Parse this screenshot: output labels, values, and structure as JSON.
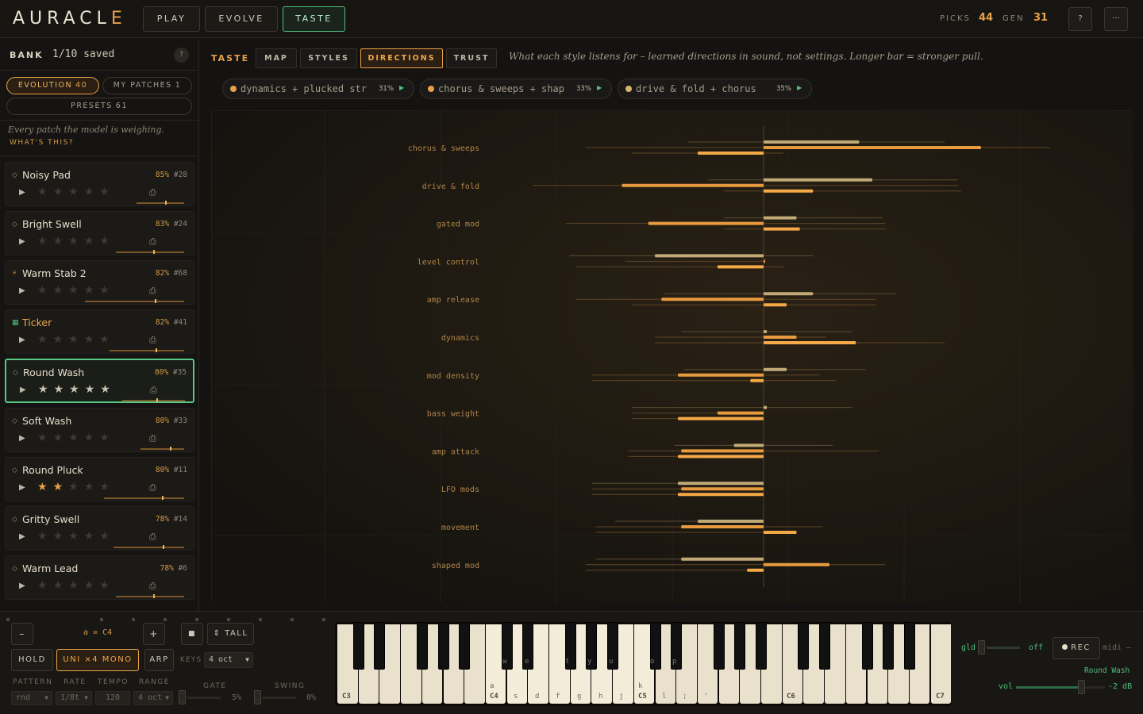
{
  "app": {
    "title": "AURACLE",
    "nav_tabs": [
      {
        "label": "PLAY"
      },
      {
        "label": "EVOLVE"
      },
      {
        "label": "TASTE"
      }
    ],
    "stats": {
      "picks_label": "PICKS",
      "picks_value": "44",
      "gen_label": "GEN",
      "gen_value": "31"
    },
    "help_label": "?",
    "more_label": "···"
  },
  "sidebar": {
    "bank_label": "BANK",
    "bank_saved": "1/10 saved",
    "help_label": "?",
    "filters": {
      "evolution_label": "EVOLUTION",
      "evolution_count": "40",
      "my_patches_label": "MY PATCHES",
      "my_patches_count": "1",
      "presets_label": "PRESETS",
      "presets_count": "61"
    },
    "note": "Every patch the model is weighing.",
    "what_label": "WHAT'S THIS?",
    "patches": [
      {
        "name": "Noisy Pad",
        "match": "85%",
        "id": "#28",
        "glyph": "◇",
        "stars": 0,
        "marker": 0.6
      },
      {
        "name": "Bright Swell",
        "match": "83%",
        "id": "#24",
        "glyph": "◇",
        "stars": 0,
        "marker": 0.55
      },
      {
        "name": "Warm Stab 2",
        "match": "82%",
        "id": "#68",
        "glyph": "⚡",
        "stars": 0,
        "marker": 0.7
      },
      {
        "name": "Ticker",
        "match": "82%",
        "id": "#41",
        "glyph": "▦",
        "stars": 0,
        "marker": 0.62
      },
      {
        "name": "Round Wash",
        "match": "80%",
        "id": "#35",
        "glyph": "◇",
        "stars": 5,
        "marker": 0.55
      },
      {
        "name": "Soft Wash",
        "match": "80%",
        "id": "#33",
        "glyph": "◇",
        "stars": 0,
        "marker": 0.68
      },
      {
        "name": "Round Pluck",
        "match": "80%",
        "id": "#11",
        "glyph": "◇",
        "stars": 2,
        "marker": 0.72
      },
      {
        "name": "Gritty Swell",
        "match": "78%",
        "id": "#14",
        "glyph": "◇",
        "stars": 0,
        "marker": 0.7
      },
      {
        "name": "Warm Lead",
        "match": "78%",
        "id": "#6",
        "glyph": "◇",
        "stars": 0,
        "marker": 0.55
      }
    ],
    "play_glyph": "▶",
    "star_glyph": "★",
    "save_glyph": "⎙"
  },
  "main": {
    "section_label": "TASTE",
    "subtabs": [
      {
        "label": "MAP"
      },
      {
        "label": "STYLES"
      },
      {
        "label": "DIRECTIONS"
      },
      {
        "label": "TRUST"
      }
    ],
    "description": "What each style listens for – learned directions in sound, not settings. Longer bar = stronger pull.",
    "styles": [
      {
        "label": "dynamics + plucked str",
        "pct": "31%",
        "color": "#e8a147"
      },
      {
        "label": "chorus & sweeps + shap",
        "pct": "33%",
        "color": "#e8a147"
      },
      {
        "label": "drive & fold + chorus",
        "pct": "35%",
        "color": "#d9b46a"
      }
    ],
    "play_glyph": "▶"
  },
  "chart_data": {
    "type": "bar",
    "orientation": "horizontal",
    "center": 0,
    "xlim": [
      -1,
      1
    ],
    "categories": [
      "chorus & sweeps",
      "drive & fold",
      "gated mod",
      "level control",
      "amp release",
      "dynamics",
      "mod density",
      "bass weight",
      "amp attack",
      "LFO mods",
      "movement",
      "shaped mod"
    ],
    "series": [
      {
        "color": "#d9bf86",
        "values": [
          0.29,
          0.33,
          0.1,
          -0.33,
          0.15,
          0.01,
          0.07,
          0.01,
          -0.09,
          -0.26,
          -0.2,
          -0.25
        ],
        "ranges": [
          [
            -0.23,
            0.55
          ],
          [
            -0.17,
            0.59
          ],
          [
            -0.12,
            0.36
          ],
          [
            -0.59,
            0.15
          ],
          [
            -0.3,
            0.4
          ],
          [
            -0.25,
            0.27
          ],
          [
            -0.24,
            0.31
          ],
          [
            -0.4,
            0.27
          ],
          [
            -0.27,
            0.21
          ],
          [
            -0.52,
            0.0
          ],
          [
            -0.45,
            0.0
          ],
          [
            -0.51,
            0.0
          ]
        ]
      },
      {
        "color": "#f0a040",
        "values": [
          0.66,
          -0.43,
          -0.35,
          0.0,
          -0.31,
          0.1,
          -0.26,
          -0.14,
          -0.25,
          -0.25,
          -0.25,
          0.2
        ],
        "ranges": [
          [
            -0.54,
            0.87
          ],
          [
            -0.7,
            0.59
          ],
          [
            -0.6,
            0.37
          ],
          [
            -0.42,
            0.0
          ],
          [
            -0.57,
            0.34
          ],
          [
            -0.33,
            0.19
          ],
          [
            -0.52,
            0.17
          ],
          [
            -0.4,
            0.0
          ],
          [
            -0.41,
            0.35
          ],
          [
            -0.52,
            0.0
          ],
          [
            -0.51,
            0.18
          ],
          [
            -0.54,
            0.37
          ]
        ]
      },
      {
        "color": "#ffb04a",
        "values": [
          -0.2,
          0.15,
          0.11,
          -0.14,
          0.07,
          0.28,
          -0.04,
          -0.26,
          -0.26,
          -0.26,
          0.1,
          -0.05
        ],
        "ranges": [
          [
            -0.4,
            0.06
          ],
          [
            -0.12,
            0.6
          ],
          [
            -0.12,
            0.37
          ],
          [
            -0.57,
            0.06
          ],
          [
            -0.4,
            0.34
          ],
          [
            -0.33,
            0.55
          ],
          [
            -0.52,
            0.22
          ],
          [
            -0.4,
            0.0
          ],
          [
            -0.41,
            0.0
          ],
          [
            -0.52,
            0.0
          ],
          [
            -0.51,
            0.0
          ],
          [
            -0.54,
            0.0
          ]
        ]
      }
    ]
  },
  "bottom": {
    "minus_label": "–",
    "plus_label": "+",
    "octave_label": "a = C4",
    "stop_glyph": "■",
    "tall_label": "⇕ TALL",
    "hold_label": "HOLD",
    "voice_label": "UNI ×4 MONO",
    "arp_label": "ARP",
    "keys_label": "KEYS",
    "keys_value": "4 oct",
    "pattern_label": "PATTERN",
    "pattern_value": "rnd",
    "rate_label": "RATE",
    "rate_value": "1/8t",
    "tempo_label": "TEMPO",
    "tempo_value": "120",
    "range_label": "RANGE",
    "range_value": "4 oct",
    "gate_label": "GATE",
    "gate_value": "5%",
    "swing_label": "SWING",
    "swing_value": "0%",
    "piano_labels": [
      {
        "text": "C3"
      },
      {
        "text": "a"
      },
      {
        "text": "C4"
      },
      {
        "text": "s"
      },
      {
        "text": "d"
      },
      {
        "text": "f"
      },
      {
        "text": "g"
      },
      {
        "text": "h"
      },
      {
        "text": "j"
      },
      {
        "text": "k"
      },
      {
        "text": "C5"
      },
      {
        "text": "l"
      },
      {
        "text": ";"
      },
      {
        "text": "'"
      },
      {
        "text": "C6"
      },
      {
        "text": "C7"
      }
    ],
    "black_key_labels": [
      "w",
      "e",
      "t",
      "y",
      "u",
      "o",
      "p"
    ],
    "glide_label": "gld",
    "glide_value": "off",
    "rec_label": "REC",
    "midi_label": "midi –",
    "patch_name": "Round Wash",
    "vol_label": "vol",
    "vol_value": "-2 dB"
  }
}
